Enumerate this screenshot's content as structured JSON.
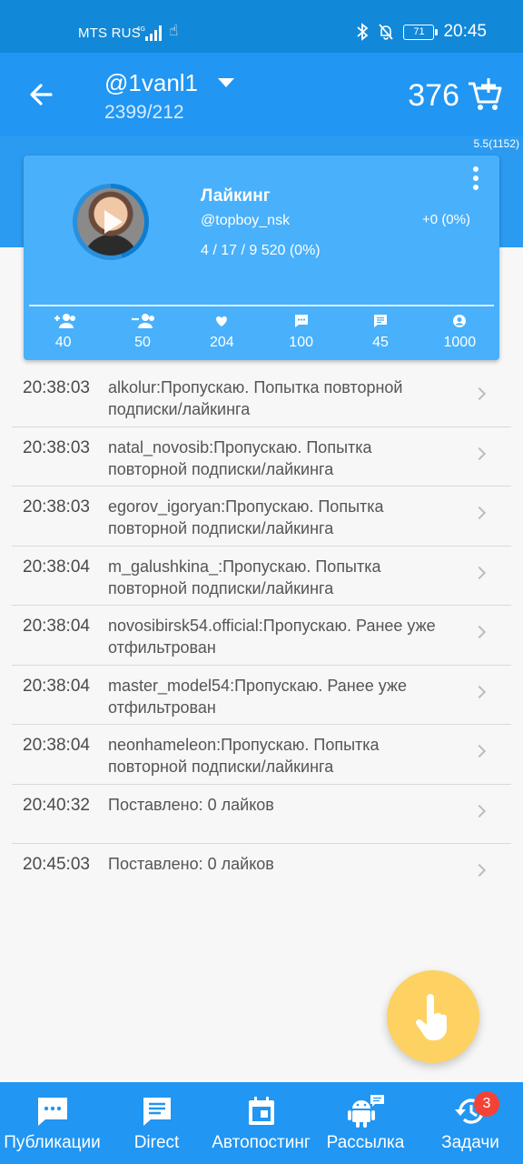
{
  "status_bar": {
    "carrier": "MTS RUS",
    "time": "20:45",
    "battery": "71"
  },
  "header": {
    "account": "@1vanl1",
    "stats": "2399/212",
    "coins": "376",
    "version": "5.5(1152)"
  },
  "card": {
    "title": "Лайкинг",
    "username": "@topboy_nsk",
    "delta": "+0 (0%)",
    "counts": "4 / 17 / 9 520 (0%)",
    "stats": [
      {
        "icon": "follow-icon",
        "value": "40"
      },
      {
        "icon": "unfollow-icon",
        "value": "50"
      },
      {
        "icon": "heart-icon",
        "value": "204"
      },
      {
        "icon": "comment-icon",
        "value": "100"
      },
      {
        "icon": "message-icon",
        "value": "45"
      },
      {
        "icon": "account-icon",
        "value": "1000"
      }
    ]
  },
  "log": [
    {
      "time": "20:38:03",
      "text": "alkolur:Пропускаю. Попытка повторной подписки/лайкинга"
    },
    {
      "time": "20:38:03",
      "text": "natal_novosib:Пропускаю. Попытка повторной подписки/лайкинга"
    },
    {
      "time": "20:38:03",
      "text": "egorov_igoryan:Пропускаю. Попытка повторной подписки/лайкинга"
    },
    {
      "time": "20:38:04",
      "text": "m_galushkina_:Пропускаю. Попытка повторной подписки/лайкинга"
    },
    {
      "time": "20:38:04",
      "text": "novosibirsk54.official:Пропускаю. Ранее уже отфильтрован"
    },
    {
      "time": "20:38:04",
      "text": "master_model54:Пропускаю. Ранее уже отфильтрован"
    },
    {
      "time": "20:38:04",
      "text": "neonhameleon:Пропускаю. Попытка повторной подписки/лайкинга"
    },
    {
      "time": "20:40:32",
      "text": "Поставлено: 0 лайков"
    },
    {
      "time": "20:45:03",
      "text": "Поставлено: 0 лайков"
    }
  ],
  "nav": [
    {
      "label": "Публикации",
      "icon": "publications-icon"
    },
    {
      "label": "Direct",
      "icon": "direct-icon"
    },
    {
      "label": "Автопостинг",
      "icon": "calendar-icon"
    },
    {
      "label": "Рассылка",
      "icon": "android-icon"
    },
    {
      "label": "Задачи",
      "icon": "history-icon",
      "badge": "3"
    }
  ],
  "colors": {
    "primary": "#2196f3",
    "card": "#49b0fb",
    "fab": "#fdd263",
    "badge": "#f44336"
  }
}
